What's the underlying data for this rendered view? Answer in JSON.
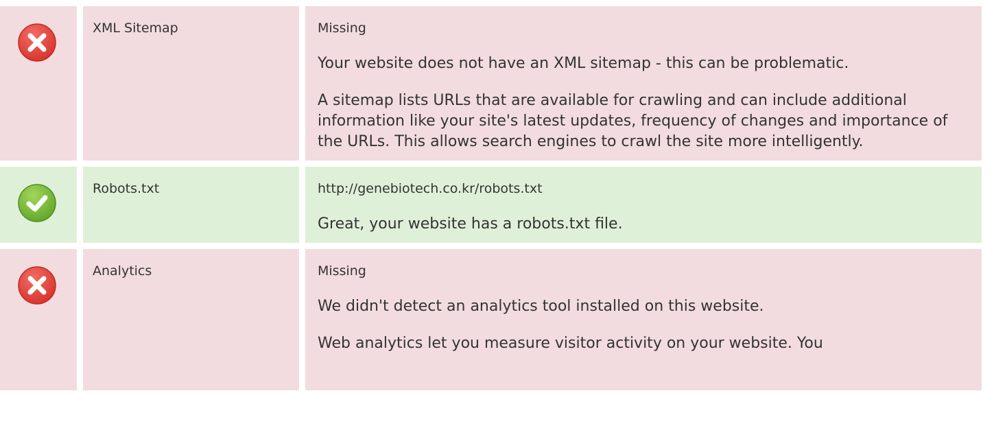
{
  "colors": {
    "fail_bg": "#f2dcdf",
    "pass_bg": "#dff0d8",
    "fail_icon": "#e0473f",
    "pass_icon": "#7dbe3a"
  },
  "rows": [
    {
      "status": "fail",
      "icon": "error-x-icon",
      "label": "XML Sitemap",
      "value": "Missing",
      "paragraphs": [
        "Your website does not have an XML sitemap - this can be problematic.",
        "A sitemap lists URLs that are available for crawling and can include additional information like your site's latest updates, frequency of changes and importance of the URLs. This allows search engines to crawl the site more intelligently."
      ]
    },
    {
      "status": "pass",
      "icon": "success-check-icon",
      "label": "Robots.txt",
      "value": "http://genebiotech.co.kr/robots.txt",
      "paragraphs": [
        "Great, your website has a robots.txt file."
      ]
    },
    {
      "status": "fail",
      "icon": "error-x-icon",
      "label": "Analytics",
      "value": "Missing",
      "paragraphs": [
        "We didn't detect an analytics tool installed on this website.",
        "Web analytics let you measure visitor activity on your website. You"
      ]
    }
  ]
}
